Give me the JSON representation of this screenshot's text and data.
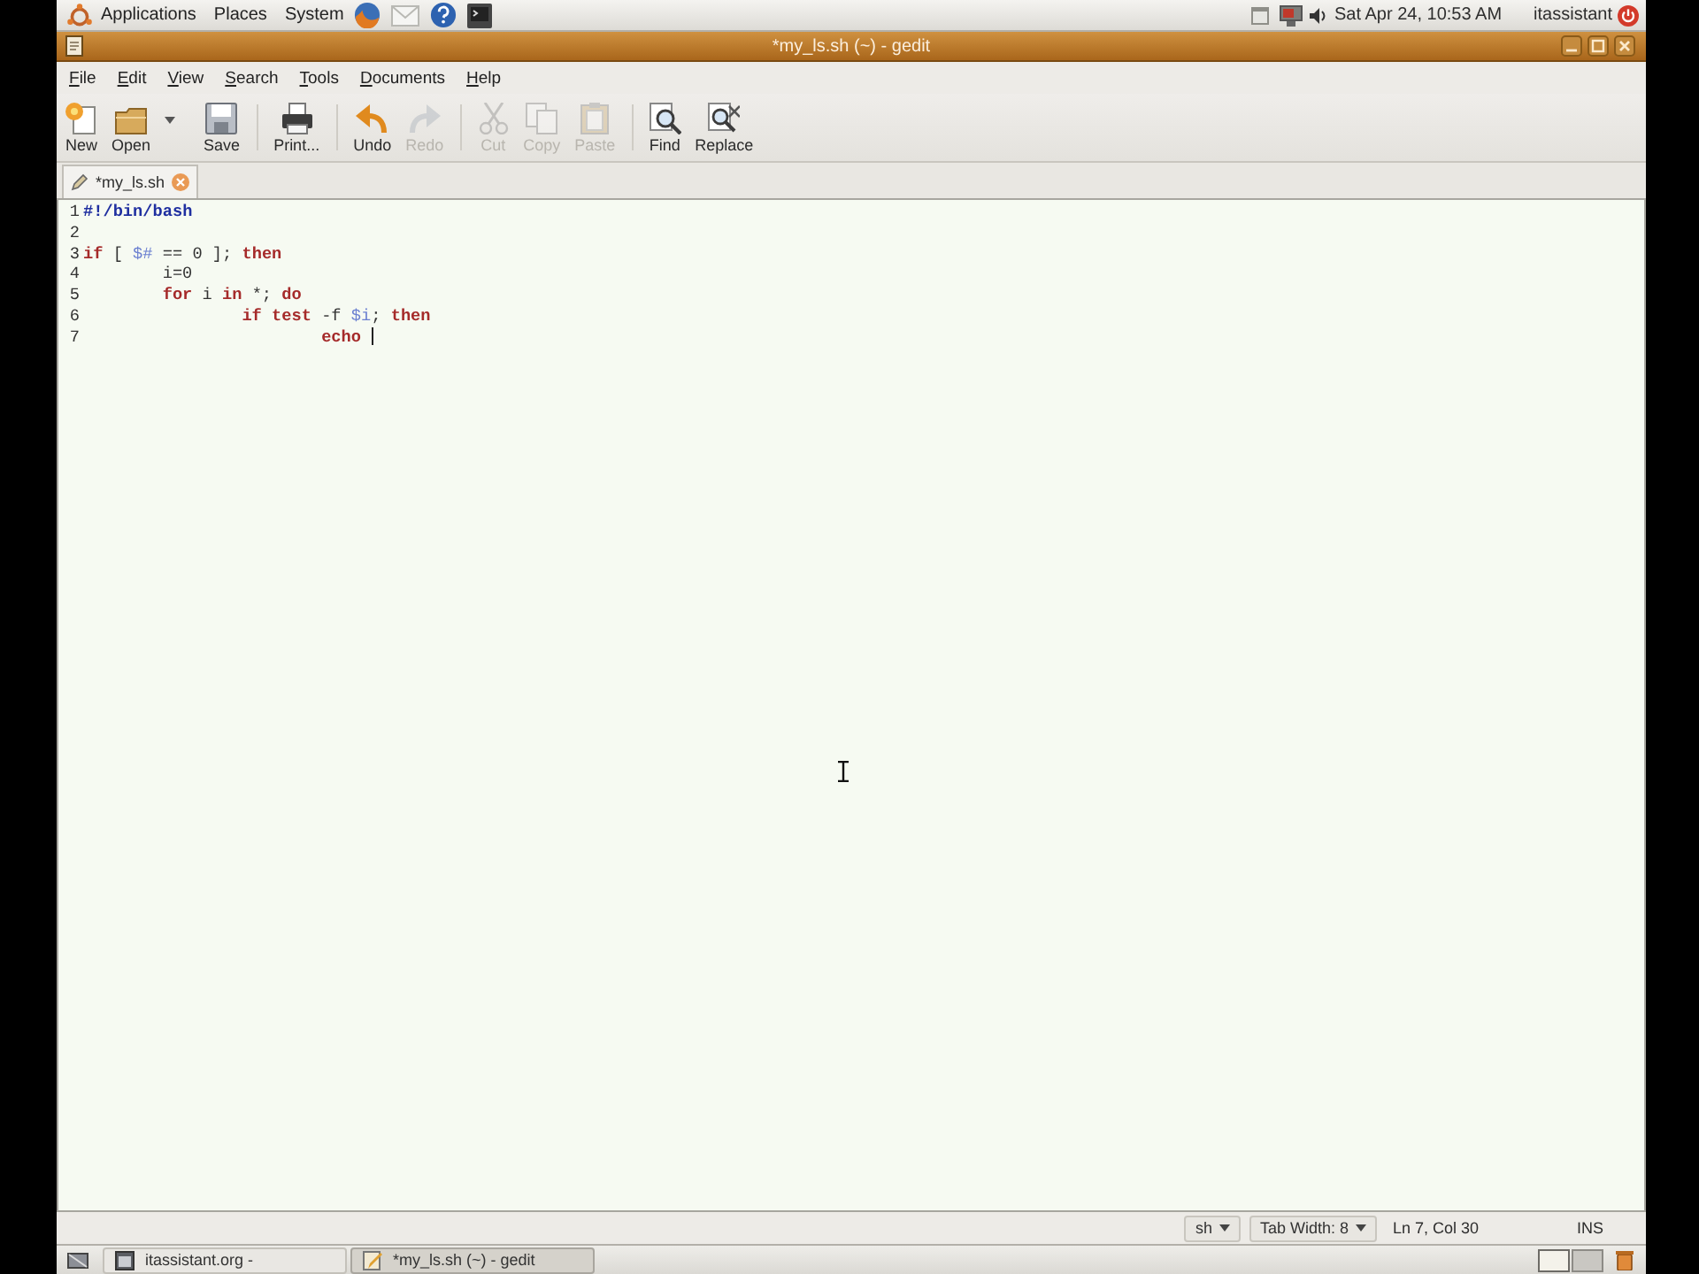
{
  "top_panel": {
    "menus": [
      "Applications",
      "Places",
      "System"
    ],
    "clock": "Sat Apr 24, 10:53 AM",
    "user": "itassistant"
  },
  "window": {
    "title": "*my_ls.sh (~) - gedit"
  },
  "menu_bar": {
    "items": [
      "File",
      "Edit",
      "View",
      "Search",
      "Tools",
      "Documents",
      "Help"
    ]
  },
  "toolbar": {
    "groups": [
      [
        {
          "label": "New",
          "disabled": false,
          "dropdown": false
        },
        {
          "label": "Open",
          "disabled": false,
          "dropdown": true
        },
        {
          "label": "Save",
          "disabled": false,
          "dropdown": false
        }
      ],
      [
        {
          "label": "Print...",
          "disabled": false,
          "dropdown": false
        }
      ],
      [
        {
          "label": "Undo",
          "disabled": false,
          "dropdown": false
        },
        {
          "label": "Redo",
          "disabled": true,
          "dropdown": false
        }
      ],
      [
        {
          "label": "Cut",
          "disabled": true,
          "dropdown": false
        },
        {
          "label": "Copy",
          "disabled": true,
          "dropdown": false
        },
        {
          "label": "Paste",
          "disabled": true,
          "dropdown": false
        }
      ],
      [
        {
          "label": "Find",
          "disabled": false,
          "dropdown": false
        },
        {
          "label": "Replace",
          "disabled": false,
          "dropdown": false
        }
      ]
    ]
  },
  "tabs": [
    {
      "label": "*my_ls.sh",
      "selected": true
    }
  ],
  "editor": {
    "lines": [
      {
        "number": "1",
        "cursor": false,
        "tokens": [
          {
            "text": "#!/bin/bash",
            "kind": "comment"
          }
        ]
      },
      {
        "number": "2",
        "cursor": false
      },
      {
        "number": "3",
        "cursor": false,
        "tokens": [
          {
            "text": "if",
            "kind": "keyword"
          },
          {
            "text": " [ ",
            "kind": "plain"
          },
          {
            "text": "$#",
            "kind": "variable"
          },
          {
            "text": " == 0 ]; ",
            "kind": "plain"
          },
          {
            "text": "then",
            "kind": "keyword"
          }
        ],
        "children": [
          {
            "number": "4",
            "cursor": false,
            "tokens": [
              {
                "text": "i=0",
                "kind": "plain"
              }
            ]
          },
          {
            "number": "5",
            "cursor": false,
            "tokens": [
              {
                "text": "for",
                "kind": "keyword"
              },
              {
                "text": " i ",
                "kind": "plain"
              },
              {
                "text": "in",
                "kind": "keyword"
              },
              {
                "text": " *; ",
                "kind": "plain"
              },
              {
                "text": "do",
                "kind": "keyword"
              }
            ],
            "children": [
              {
                "number": "6",
                "cursor": false,
                "tokens": [
                  {
                    "text": "if",
                    "kind": "keyword"
                  },
                  {
                    "text": " test",
                    "kind": "builtin"
                  },
                  {
                    "text": " -f ",
                    "kind": "plain"
                  },
                  {
                    "text": "$i",
                    "kind": "variable"
                  },
                  {
                    "text": "; ",
                    "kind": "plain"
                  },
                  {
                    "text": "then",
                    "kind": "keyword"
                  }
                ],
                "children": [
                  {
                    "number": "7",
                    "cursor": true,
                    "tokens": [
                      {
                        "text": "echo",
                        "kind": "builtin"
                      }
                    ]
                  }
                ]
              }
            ]
          }
        ]
      }
    ]
  },
  "status_bar": {
    "language": "sh",
    "tab_width": "Tab Width: 8",
    "position": "Ln 7, Col 30",
    "mode": "INS"
  },
  "bottom_panel": {
    "tasks": [
      {
        "label": "itassistant.org -",
        "selected": false
      },
      {
        "label": "*my_ls.sh (~) - gedit",
        "selected": true
      }
    ],
    "workspaces": [
      {
        "selected": true
      },
      {
        "selected": false
      }
    ]
  }
}
